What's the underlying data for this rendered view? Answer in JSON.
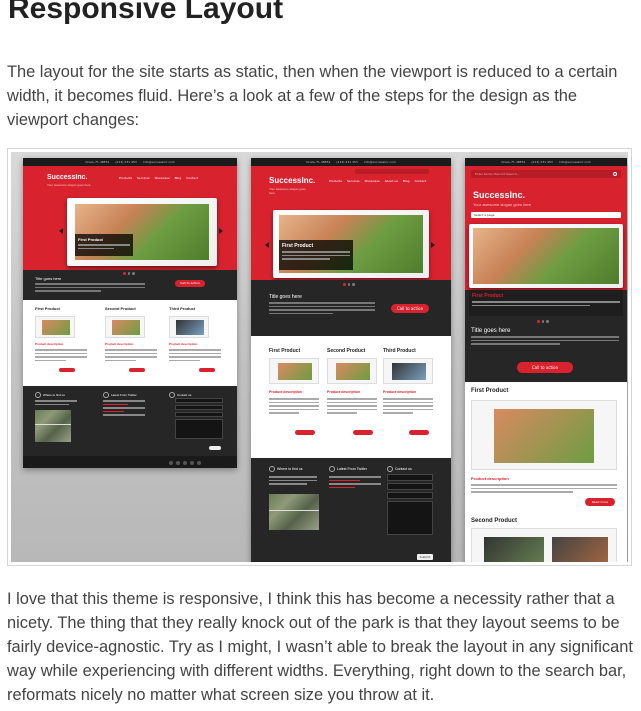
{
  "heading": "Responsive Layout",
  "intro": "The layout for the site starts as static, then when the viewport is reduced to a certain width, it becomes fluid. Here’s a look at a few of the steps for the design as the viewport changes:",
  "closing": "I love that this theme is responsive, I think this has become a necessity rather that a nicety. The thing that they really knock out of the park is that they layout seems to be fairly device-agnostic. Try as I might, I wasn’t able to break the layout in any significant way while experiencing with different widths. Everything, right down to the search bar, reformats nicely no matter what screen size you throw at it.",
  "mockup": {
    "address": "Ocala, FL 48851",
    "phone": "(213) 231 453",
    "email": "info@successinc.com",
    "logo": "SuccessInc.",
    "slogan": "Your awesome slogan goes here",
    "search_placeholder": "Enter terms then hit Search...",
    "select_page": "Select a page",
    "nav": [
      "Products",
      "Services",
      "Showcase",
      "Blog",
      "Contact",
      "About us"
    ],
    "slide_caption": "First Product",
    "title_here": "Title goes here",
    "call_to_action": "Call to action",
    "products": [
      "First Product",
      "Second Product",
      "Third Product"
    ],
    "product_description": "Product description",
    "read_more": "Read more",
    "footer_find": "Where to find us",
    "footer_twitter": "Latest From Twitter",
    "footer_contact": "Contact us",
    "submit": "Submit"
  },
  "colors": {
    "brand_red": "#d8232f",
    "dark": "#262626",
    "text": "#444444"
  }
}
